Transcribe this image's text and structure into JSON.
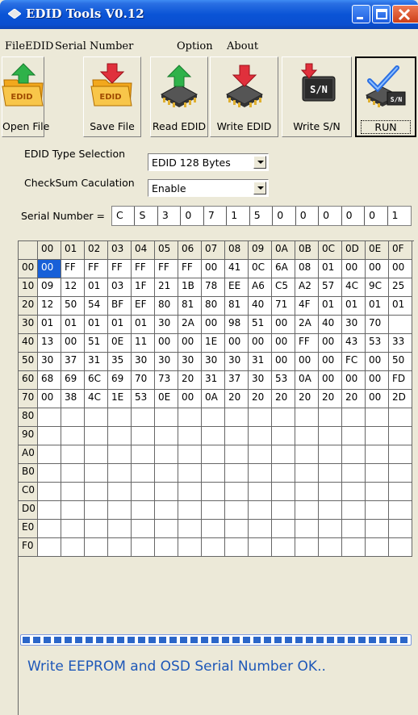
{
  "window": {
    "title": "EDID Tools V0.12"
  },
  "menu": {
    "file": "File",
    "edid": "EDID",
    "serial": "Serial Number",
    "option": "Option",
    "about": "About"
  },
  "toolbar": {
    "open": "Open File",
    "save": "Save File",
    "read": "Read EDID",
    "write": "Write EDID",
    "write_sn": "Write S/N",
    "run": "RUN",
    "sn_chip_label": "S/N"
  },
  "settings": {
    "edid_type_label": "EDID Type Selection",
    "edid_type_value": "EDID 128 Bytes",
    "checksum_label": "CheckSum Caculation",
    "checksum_value": "Enable",
    "serial_label": "Serial Number =",
    "serial_chars": [
      "C",
      "S",
      "3",
      "0",
      "7",
      "1",
      "5",
      "0",
      "0",
      "0",
      "0",
      "0",
      "1"
    ]
  },
  "grid": {
    "col_headers": [
      "00",
      "01",
      "02",
      "03",
      "04",
      "05",
      "06",
      "07",
      "08",
      "09",
      "0A",
      "0B",
      "0C",
      "0D",
      "0E",
      "0F"
    ],
    "rows": [
      {
        "addr": "00",
        "bytes": [
          "00",
          "FF",
          "FF",
          "FF",
          "FF",
          "FF",
          "FF",
          "00",
          "41",
          "0C",
          "6A",
          "08",
          "01",
          "00",
          "00",
          "00"
        ]
      },
      {
        "addr": "10",
        "bytes": [
          "09",
          "12",
          "01",
          "03",
          "1F",
          "21",
          "1B",
          "78",
          "EE",
          "A6",
          "C5",
          "A2",
          "57",
          "4C",
          "9C",
          "25"
        ]
      },
      {
        "addr": "20",
        "bytes": [
          "12",
          "50",
          "54",
          "BF",
          "EF",
          "80",
          "81",
          "80",
          "81",
          "40",
          "71",
          "4F",
          "01",
          "01",
          "01",
          "01"
        ]
      },
      {
        "addr": "30",
        "bytes": [
          "01",
          "01",
          "01",
          "01",
          "01",
          "30",
          "2A",
          "00",
          "98",
          "51",
          "00",
          "2A",
          "40",
          "30",
          "70"
        ]
      },
      {
        "addr": "40",
        "bytes": [
          "13",
          "00",
          "51",
          "0E",
          "11",
          "00",
          "00",
          "1E",
          "00",
          "00",
          "00",
          "FF",
          "00",
          "43",
          "53",
          "33"
        ]
      },
      {
        "addr": "50",
        "bytes": [
          "30",
          "37",
          "31",
          "35",
          "30",
          "30",
          "30",
          "30",
          "30",
          "31",
          "00",
          "00",
          "00",
          "FC",
          "00",
          "50"
        ]
      },
      {
        "addr": "60",
        "bytes": [
          "68",
          "69",
          "6C",
          "69",
          "70",
          "73",
          "20",
          "31",
          "37",
          "30",
          "53",
          "0A",
          "00",
          "00",
          "00",
          "FD"
        ]
      },
      {
        "addr": "70",
        "bytes": [
          "00",
          "38",
          "4C",
          "1E",
          "53",
          "0E",
          "00",
          "0A",
          "20",
          "20",
          "20",
          "20",
          "20",
          "20",
          "00",
          "2D"
        ]
      },
      {
        "addr": "80",
        "bytes": []
      },
      {
        "addr": "90",
        "bytes": []
      },
      {
        "addr": "A0",
        "bytes": []
      },
      {
        "addr": "B0",
        "bytes": []
      },
      {
        "addr": "C0",
        "bytes": []
      },
      {
        "addr": "D0",
        "bytes": []
      },
      {
        "addr": "E0",
        "bytes": []
      },
      {
        "addr": "F0",
        "bytes": []
      }
    ]
  },
  "progress": {
    "fraction": 1.0
  },
  "status": {
    "message": "Write EEPROM and OSD Serial Number OK.."
  },
  "colors": {
    "titlebar": "#0a54d6",
    "selection": "#1860d8",
    "progress": "#2b66c9",
    "status_text": "#1d57b8"
  },
  "icons": [
    "edid-folder-open-icon",
    "edid-folder-save-icon",
    "chip-read-icon",
    "chip-write-icon",
    "sn-write-icon",
    "run-icon"
  ]
}
